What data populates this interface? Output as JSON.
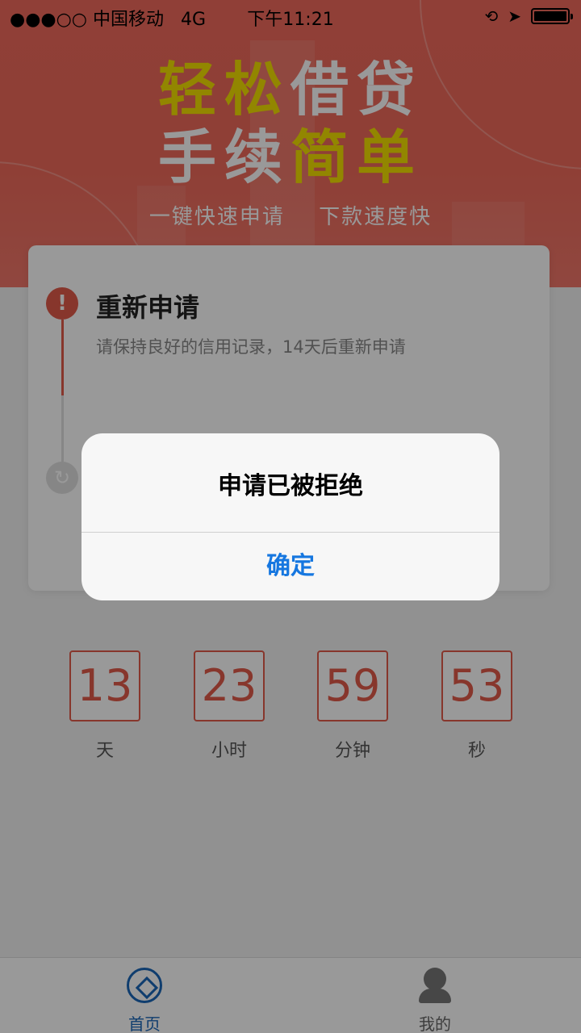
{
  "status_bar": {
    "carrier": "●●●○○ 中国移动",
    "network": "4G",
    "time": "下午11:21"
  },
  "banner": {
    "line1_part1": "轻松",
    "line1_part2": "借贷",
    "line2_part1": "手续",
    "line2_part2": "简单",
    "feature1": "一键快速申请",
    "feature2": "下款速度快",
    "colors": {
      "accent": "#f06a5c",
      "highlight": "#f4e000"
    }
  },
  "status_card": {
    "title": "重新申请",
    "description": "请保持良好的信用记录，14天后重新申请",
    "icon1": "exclamation-icon",
    "icon2": "refresh-icon"
  },
  "countdown": [
    {
      "value": "13",
      "label": "天"
    },
    {
      "value": "23",
      "label": "小时"
    },
    {
      "value": "59",
      "label": "分钟"
    },
    {
      "value": "53",
      "label": "秒"
    }
  ],
  "tabbar": {
    "home_label": "首页",
    "me_label": "我的",
    "active": "home"
  },
  "alert": {
    "title": "申请已被拒绝",
    "confirm_label": "确定"
  }
}
